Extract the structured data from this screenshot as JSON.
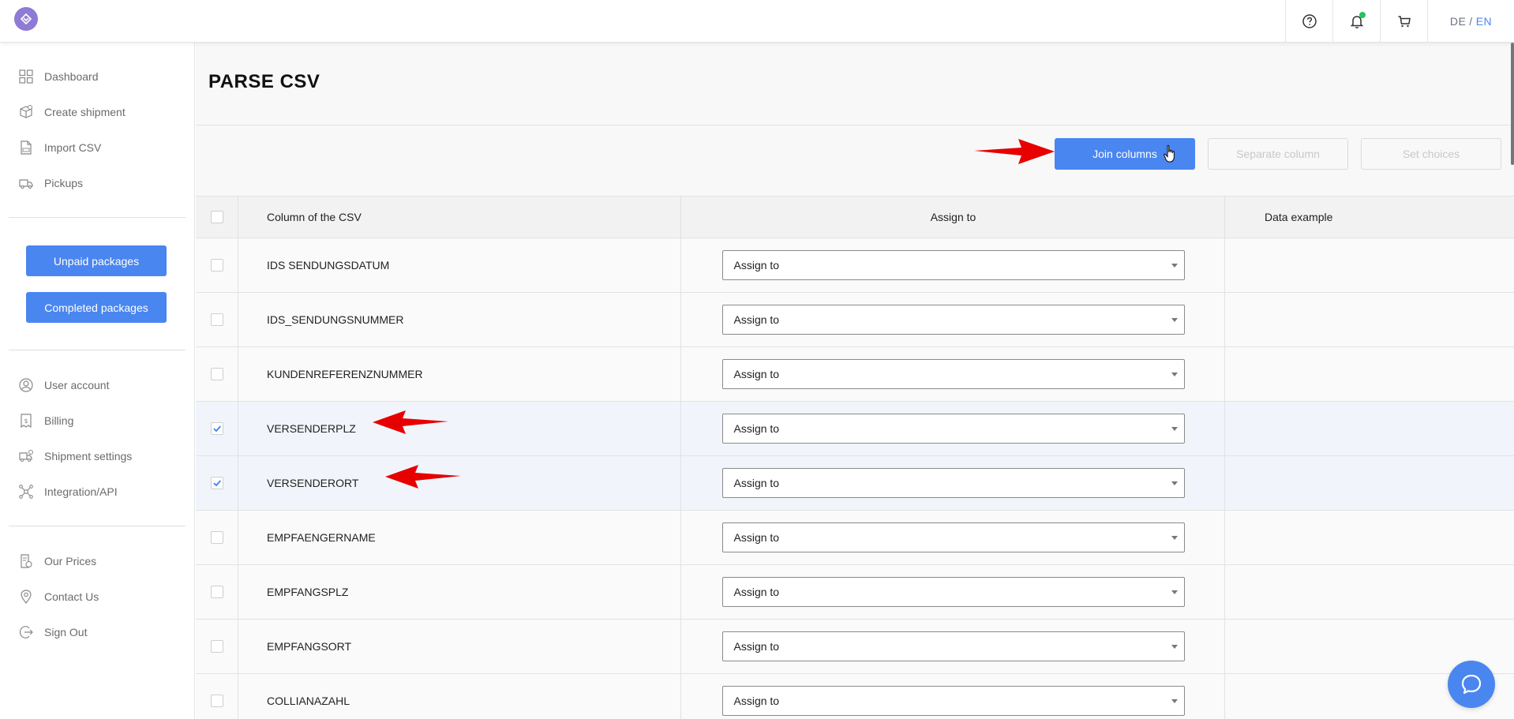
{
  "header": {
    "lang_de": "DE",
    "lang_sep": "/",
    "lang_en": "EN",
    "icons": [
      "question-icon",
      "bell-icon",
      "cart-icon"
    ]
  },
  "sidebar": {
    "nav_primary": [
      {
        "label": "Dashboard",
        "icon": "grid-icon"
      },
      {
        "label": "Create shipment",
        "icon": "package-icon"
      },
      {
        "label": "Import CSV",
        "icon": "file-csv-icon"
      },
      {
        "label": "Pickups",
        "icon": "truck-icon"
      }
    ],
    "unpaid_label": "Unpaid packages",
    "completed_label": "Completed packages",
    "nav_account": [
      {
        "label": "User account",
        "icon": "user-icon"
      },
      {
        "label": "Billing",
        "icon": "dollar-icon"
      },
      {
        "label": "Shipment settings",
        "icon": "truck-settings-icon"
      },
      {
        "label": "Integration/API",
        "icon": "network-icon"
      }
    ],
    "nav_footer": [
      {
        "label": "Our Prices",
        "icon": "price-icon"
      },
      {
        "label": "Contact Us",
        "icon": "location-icon"
      },
      {
        "label": "Sign Out",
        "icon": "sign-out-icon"
      }
    ]
  },
  "main": {
    "title": "PARSE CSV",
    "toolbar": {
      "join_label": "Join columns",
      "separate_label": "Separate column",
      "set_choices_label": "Set choices"
    },
    "table": {
      "headers": {
        "column": "Column of the CSV",
        "assign": "Assign to",
        "example": "Data example"
      },
      "rows": [
        {
          "name": "IDS SENDUNGSDATUM",
          "assign": "Assign to",
          "checked": false
        },
        {
          "name": "IDS_SENDUNGSNUMMER",
          "assign": "Assign to",
          "checked": false
        },
        {
          "name": "KUNDENREFERENZNUMMER",
          "assign": "Assign to",
          "checked": false
        },
        {
          "name": "VERSENDERPLZ",
          "assign": "Assign to",
          "checked": true
        },
        {
          "name": "VERSENDERORT",
          "assign": "Assign to",
          "checked": true
        },
        {
          "name": "EMPFAENGERNAME",
          "assign": "Assign to",
          "checked": false
        },
        {
          "name": "EMPFANGSPLZ",
          "assign": "Assign to",
          "checked": false
        },
        {
          "name": "EMPFANGSORT",
          "assign": "Assign to",
          "checked": false
        },
        {
          "name": "COLLIANAZAHL",
          "assign": "Assign to",
          "checked": false
        }
      ]
    }
  },
  "colors": {
    "accent": "#4a86f0",
    "logo": "#8e7bd6",
    "annotation": "#e60000",
    "selected_row": "#f1f5fb"
  }
}
